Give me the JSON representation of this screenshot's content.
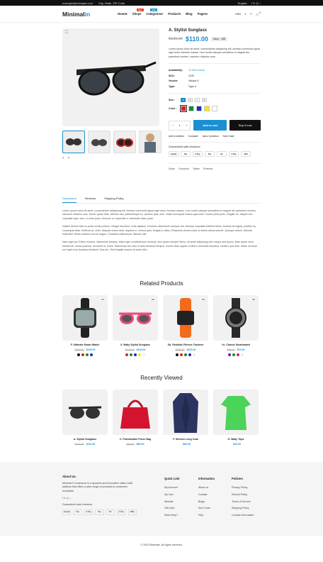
{
  "topbar": {
    "email": "example@example.com",
    "address": "City, State, ZIP Code",
    "lang": "English",
    "currency": "USD",
    "social": [
      "f",
      "x",
      "ig",
      "tt"
    ]
  },
  "header": {
    "logo_a": "Minimal",
    "logo_b": "in",
    "nav": [
      {
        "label": "Home",
        "badge": ""
      },
      {
        "label": "Shop",
        "badge": "New",
        "badge_color": "#e5322d"
      },
      {
        "label": "Categories",
        "badge": "Sale",
        "badge_color": "#1a8fd1"
      },
      {
        "label": "Products",
        "badge": ""
      },
      {
        "label": "Blog",
        "badge": ""
      },
      {
        "label": "Pages",
        "badge": ""
      }
    ],
    "wishlist": "Wishlist",
    "cart_count": "0"
  },
  "product": {
    "title": "A. Stylist Sunglass",
    "old_price": "$130.00",
    "price": "$110.00",
    "save": "Save - 15$",
    "description": "Lorem ipsum dolor sit amet, consectetuer adipiscing elit. Aenean commodo ligula eget dolor. Aenean massa. Cum sociis natoque penatibus et magnis dis parturient montes, nascetur ridiculus mus.",
    "meta": [
      {
        "k": "Availability:",
        "v": "12 left in stock",
        "stock": true
      },
      {
        "k": "SKU:",
        "v": "1190"
      },
      {
        "k": "Vendor:",
        "v": "Vendor 5"
      },
      {
        "k": "Type:",
        "v": "Type 4"
      }
    ],
    "size_label": "Size :",
    "sizes": [
      "S",
      "M",
      "L",
      "XL"
    ],
    "color_label": "Color :",
    "colors": [
      "#e31c25",
      "#1b8a2e",
      "#1d2fb5",
      "#f5e51c",
      "#ffffff"
    ],
    "qty": "1",
    "add_to_cart": "Add to cart",
    "buy_now": "Buy it now",
    "actions": [
      "Add to wishlist",
      "Compare",
      "Ask a Question",
      "Size Chart"
    ],
    "guaranteed": "Guaranteed safe checkout",
    "payments": [
      "shopify",
      "Pay",
      "G Pay",
      "Pay",
      "btc",
      "G Pay",
      "VISA"
    ],
    "share_label": "Share",
    "share": [
      "Facebook",
      "Twitter",
      "Pinterest"
    ]
  },
  "tabs": {
    "items": [
      "Description",
      "Reviews",
      "Shipping Policy"
    ],
    "paragraphs": [
      "Lorem ipsum dolor sit amet, consectetuer adipiscing elit. Aenean commodo ligula eget dolor. Aenean massa. Cum sociis natoque penatibus et magnis dis parturient montes, nascetur ridiculus mus. Donec quam felis, ultricies nec, pellentesque eu, pretium quis, sem. Nulla consequat massa quis enim. Donec pede justo, fringilla vel, aliquet nec, vulputate eget, arcu. In enim justo, rhoncus ut, imperdiet a, venenatis vitae, justo.",
      "Nullam dictum felis eu pede mollis pretium. Integer tincidunt. Cras dapibus. Vivamus elementum semper nisi. Aenean vulputate eleifend tellus. Aenean leo ligula, porttitor eu, consequat vitae, eleifend ac, enim. Aliquam lorem ante, dapibus in, viverra quis, feugiat a, tellus. Phasellus viverra nulla ut metus varius laoreet. Quisque rutrum. Aenean imperdiet. Etiam ultricies nisi vel augue. Curabitur ullamcorper ultricies nisi.",
      "Nam eget dui. Etiam rhoncus. Maecenas tempus, tellus eget condimentum rhoncus, sem quam semper libero, sit amet adipiscing sem neque sed ipsum. Nam quam nunc, blandit vel, luctus pulvinar, hendrerit id, lorem. Maecenas nec odio et ante tincidunt tempus. Donec vitae sapien ut libero venenatis faucibus. Nullam quis ante. Etiam sit amet orci eget eros faucibus tincidunt. Duis leo. Sed fringilla mauris sit amet nibh."
    ]
  },
  "related": {
    "title": "Related Products",
    "items": [
      {
        "name": "F. Ultimate Smart Watch",
        "old": "$130.00",
        "price": "$125.00",
        "disc": "-17$",
        "colors": [
          "#111111",
          "#e31c25",
          "#1b8a2e",
          "#1d2fb5"
        ]
      },
      {
        "name": "X. Baby Stylist Sunglass",
        "old": "$130.00",
        "price": "$110.00",
        "disc": "-15$",
        "colors": [
          "#e31c25",
          "#1b8a2e",
          "#1d2fb5",
          "#f5e51c",
          "#eeeeee"
        ]
      },
      {
        "name": "Xb. Realistic Fitness Trackers",
        "old": "$180.00",
        "price": "$110.00",
        "disc": "-15$",
        "colors": [
          "#111111",
          "#e31c25",
          "#1b8a2e",
          "#1d2fb5",
          "#eeeeee"
        ]
      },
      {
        "name": "Ys. Classic Smartwatch",
        "old": "$85.00",
        "price": "$70.00",
        "disc": "-15$",
        "colors": [
          "#6a1b9a",
          "#1b8a2e",
          "#e91e63",
          "#eeeeee"
        ]
      }
    ]
  },
  "recent": {
    "title": "Recently Viewed",
    "items": [
      {
        "name": "A. Stylist Sunglass",
        "old": "$130.00",
        "price": "$110.00"
      },
      {
        "name": "C. Fashionable Purse Bag",
        "old": "$90.00",
        "price": "$80.00"
      },
      {
        "name": "F. Women Long Coat",
        "old": "",
        "price": "$80.00"
      },
      {
        "name": "G. Baby Tops",
        "old": "",
        "price": "$33.00"
      }
    ]
  },
  "footer": {
    "about_title": "About Us.",
    "about_text": "Minimal E-Commerce is a dynamic and innovative online retail platform that offers a wide range of products to customers worldwide.",
    "guaranteed": "Guaranteed safe checkout",
    "quick_title": "Quick Link",
    "quick": [
      "My Account",
      "My Cart",
      "Wishlist",
      "Gift Card",
      "Need Help?"
    ],
    "info_title": "Information",
    "info": [
      "About us",
      "Contact",
      "Blogs",
      "Size Chart",
      "FAQ"
    ],
    "policies_title": "Policies",
    "policies": [
      "Privacy Policy",
      "Refund Policy",
      "Terms of Service",
      "Shipping Policy",
      "Contact Information"
    ],
    "copyright": "© 2023 Minimalin. All rights reserved."
  }
}
